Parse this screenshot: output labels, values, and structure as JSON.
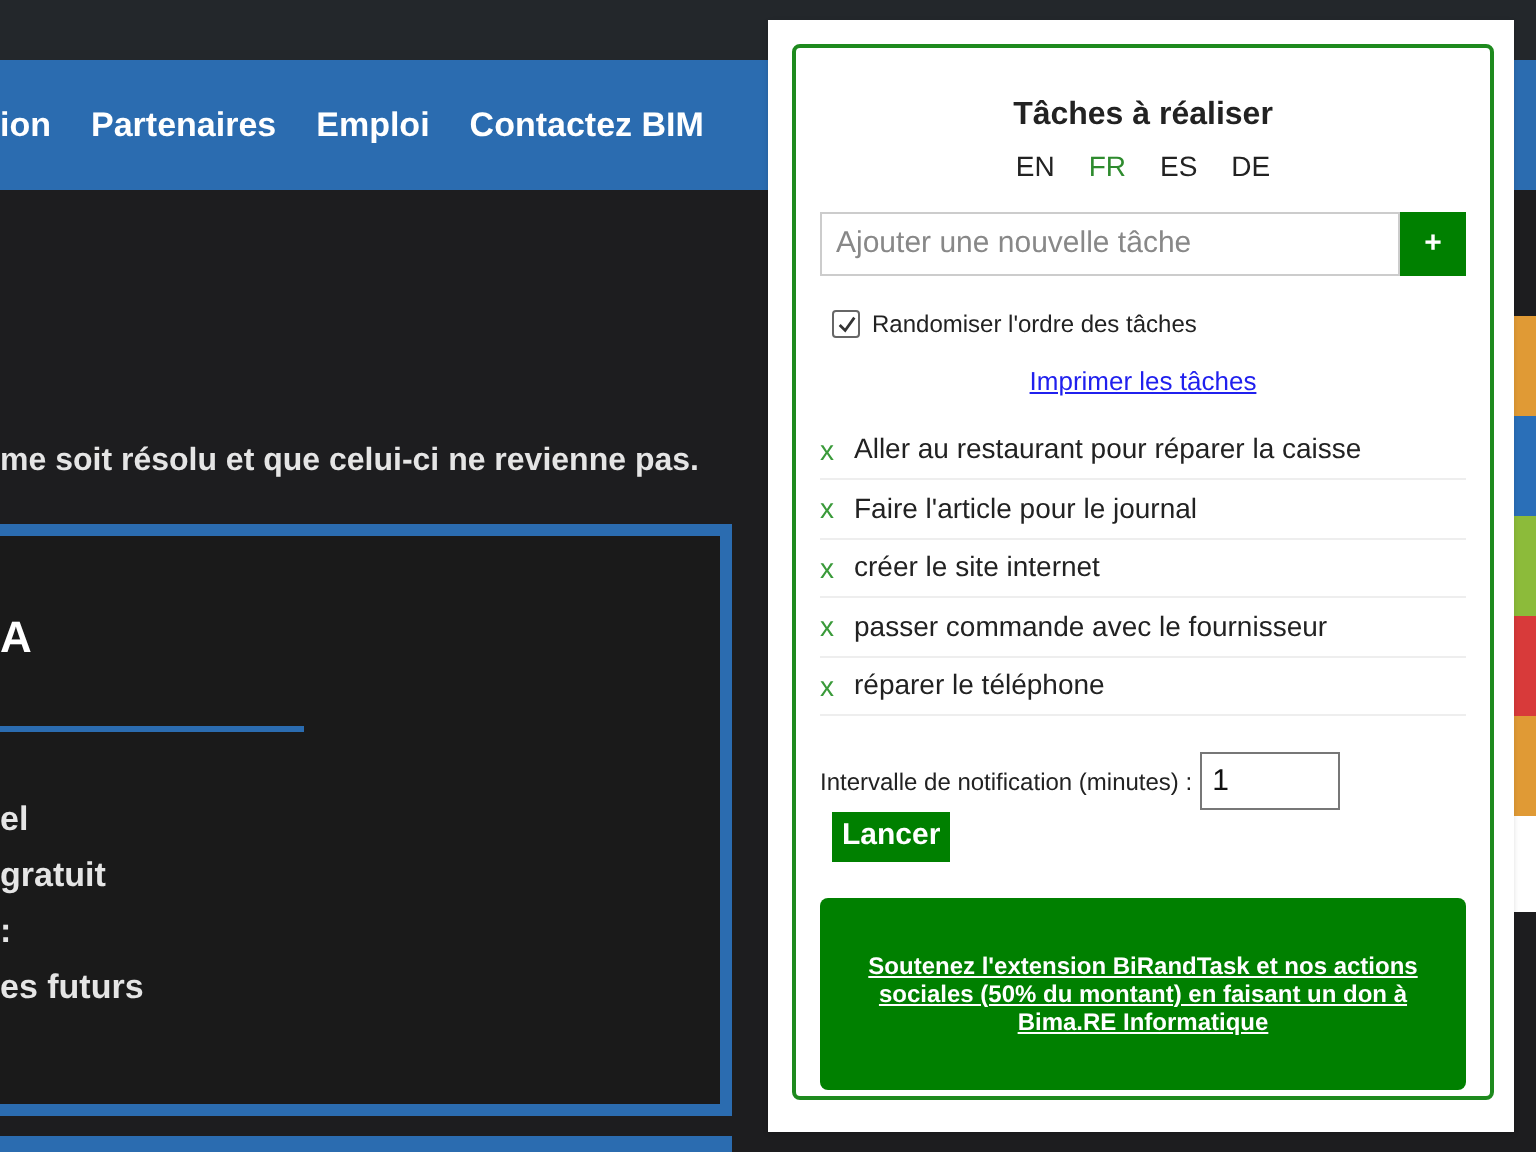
{
  "site": {
    "nav": [
      {
        "label": "ion"
      },
      {
        "label": "Partenaires"
      },
      {
        "label": "Emploi"
      },
      {
        "label": "Contactez BIM"
      }
    ],
    "body_text": "me soit résolu et que celui-ci ne revienne pas.",
    "card": {
      "heading": "A",
      "items": [
        "el",
        "gratuit",
        ":",
        "es futurs"
      ]
    },
    "side_strip": [
      {
        "color": "#e09a35"
      },
      {
        "color": "#2a6fb8"
      },
      {
        "color": "#8cbb3a"
      },
      {
        "color": "#d83a3a"
      },
      {
        "color": "#e09a35"
      }
    ]
  },
  "popup": {
    "title": "Tâches à réaliser",
    "languages": [
      {
        "label": "EN",
        "selected": false
      },
      {
        "label": "FR",
        "selected": true
      },
      {
        "label": "ES",
        "selected": false
      },
      {
        "label": "DE",
        "selected": false
      }
    ],
    "new_task": {
      "placeholder": "Ajouter une nouvelle tâche"
    },
    "add_button": "+",
    "randomize": {
      "label": "Randomiser l'ordre des tâches",
      "checked": true
    },
    "print_link": "Imprimer les tâches",
    "tasks": [
      {
        "delete": "x",
        "text": "Aller au restaurant pour réparer la caisse"
      },
      {
        "delete": "x",
        "text": "Faire l'article pour le journal"
      },
      {
        "delete": "x",
        "text": "créer le site internet"
      },
      {
        "delete": "x",
        "text": "passer commande avec le fournisseur"
      },
      {
        "delete": "x",
        "text": "réparer le téléphone"
      }
    ],
    "interval": {
      "label": "Intervalle de notification (minutes) :",
      "value": "1"
    },
    "start_button": "Lancer",
    "donate_link": "Soutenez l'extension BiRandTask et nos actions sociales (50% du montant) en faisant un don à Bima.RE Informatique"
  }
}
